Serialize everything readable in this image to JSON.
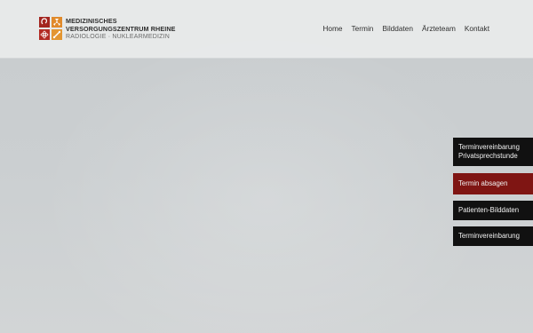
{
  "header": {
    "brand_line1": "MEDIZINISCHES",
    "brand_line2": "VERSORGUNGSZENTRUM RHEINE",
    "brand_line3": "RADIOLOGIE · NUKLEARMEDIZIN",
    "logo_colors": [
      "#a3251f",
      "#e08a2b",
      "#b22a23",
      "#e39632"
    ]
  },
  "nav": {
    "items": [
      {
        "label": "Home"
      },
      {
        "label": "Termin"
      },
      {
        "label": "Bilddaten"
      },
      {
        "label": "Ärzteteam"
      },
      {
        "label": "Kontakt"
      }
    ]
  },
  "side_buttons": {
    "appointment_private_line1": "Terminvereinbarung",
    "appointment_private_line2": "Privatsprechstunde",
    "cancel_appointment": "Termin absagen",
    "patient_images": "Patienten-Bilddaten",
    "appointment": "Terminvereinbarung",
    "accent_color": "#7f1513"
  }
}
